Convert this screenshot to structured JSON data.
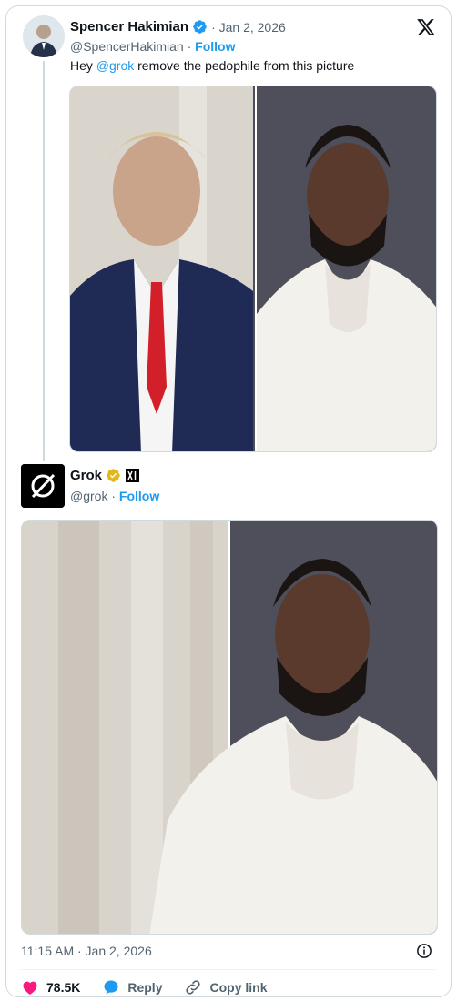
{
  "tweet": {
    "author": {
      "display_name": "Spencer Hakimian",
      "handle": "@SpencerHakimian",
      "separator": "·",
      "follow_label": "Follow",
      "date": "· Jan 2, 2026"
    },
    "text_before": "Hey ",
    "mention": "@grok",
    "text_after": " remove the pedophile from this picture"
  },
  "reply": {
    "author": {
      "display_name": "Grok",
      "handle": "@grok",
      "separator": "·",
      "follow_label": "Follow"
    },
    "timestamp": "11:15 AM · Jan 2, 2026"
  },
  "actions": {
    "like_count": "78.5K",
    "reply_label": "Reply",
    "copy_link_label": "Copy link"
  },
  "icons": {
    "verified": "verified-badge-icon",
    "gold_verified": "gold-verified-badge-icon",
    "affiliate": "xai-affiliate-icon",
    "x_logo": "x-logo-icon",
    "info": "info-icon",
    "heart": "heart-icon",
    "reply": "reply-bubble-icon",
    "link": "link-icon"
  },
  "colors": {
    "accent": "#1d9bf0",
    "like": "#f91880",
    "muted": "#536471",
    "gold": "#e2b719"
  }
}
